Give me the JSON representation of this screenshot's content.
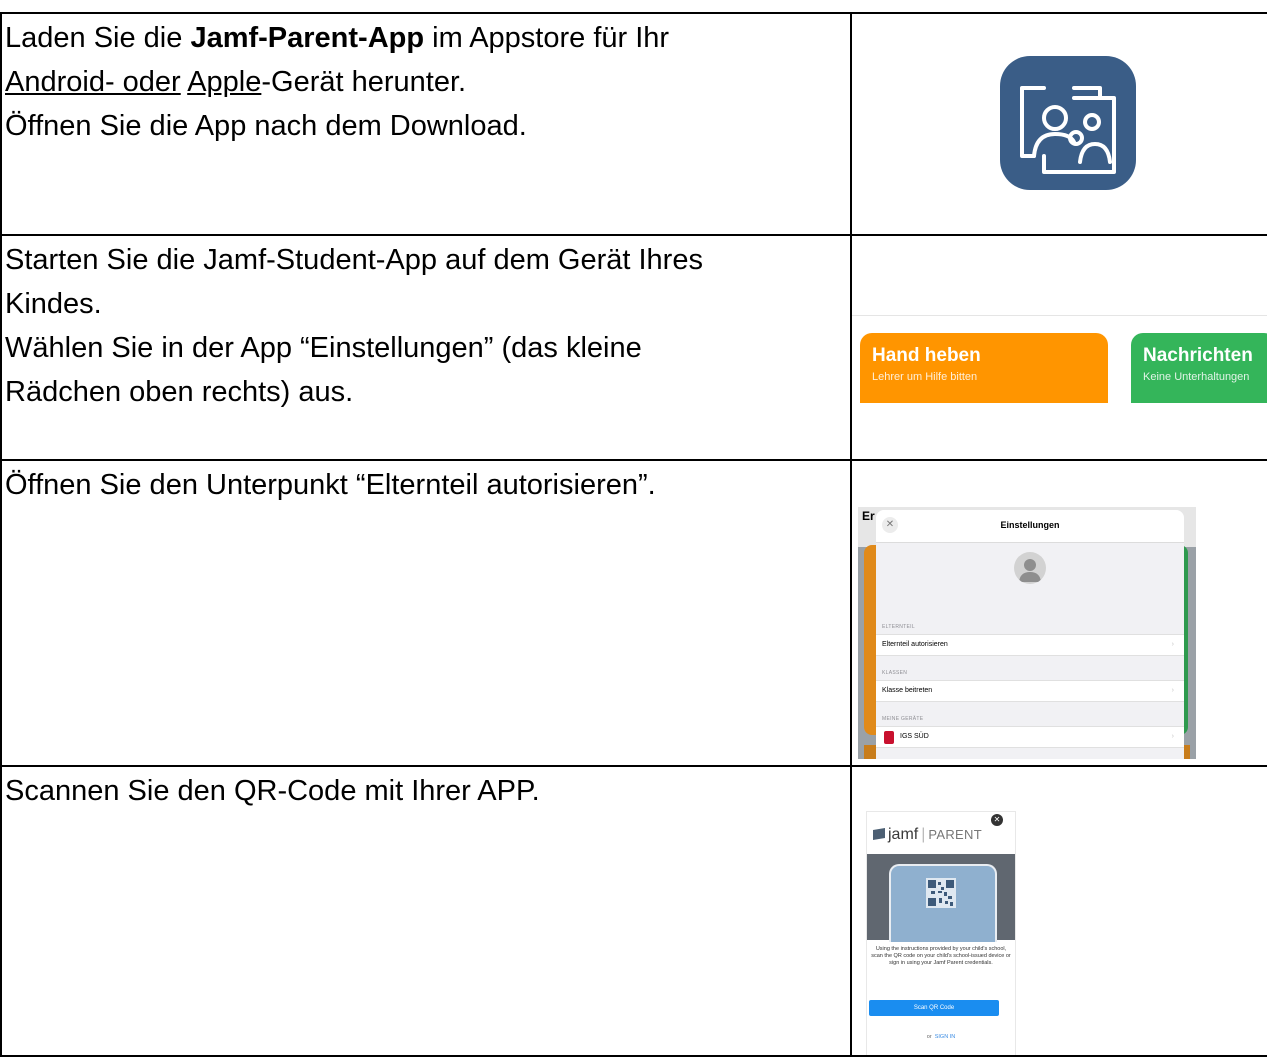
{
  "rows": [
    {
      "lines": [
        {
          "before": "Laden Sie die ",
          "bold": "Jamf-Parent-App",
          "after": " im Appstore für Ihr"
        },
        {
          "link1": "Android- oder",
          "mid": " ",
          "link2": "Apple",
          "after": "-Gerät herunter."
        },
        {
          "text": "Öffnen Sie die App nach dem Download."
        }
      ]
    },
    {
      "lines": [
        "Starten Sie die Jamf-Student-App auf dem Gerät Ihres",
        "Kindes.",
        "Wählen Sie in der App “Einstellungen” (das kleine",
        "Rädchen oben rechts) aus."
      ],
      "tiles": [
        {
          "title": "Hand heben",
          "subtitle": "Lehrer um Hilfe bitten",
          "color": "#ff9500"
        },
        {
          "title": "Nachrichten",
          "subtitle": "Keine Unterhaltungen",
          "color": "#34b55a"
        }
      ]
    },
    {
      "lines": [
        "Öffnen Sie den Unterpunkt “Elternteil autorisieren”."
      ],
      "settings": {
        "corner_text": "Er",
        "close": "✕",
        "title": "Einstellungen",
        "sections": [
          {
            "header": "ELTERNTEIL",
            "item": "Elternteil autorisieren"
          },
          {
            "header": "KLASSEN",
            "item": "Klasse beitreten"
          },
          {
            "header": "MEINE GERÄTE",
            "item": "IGS SÜD"
          }
        ],
        "chevron": "›"
      }
    },
    {
      "lines": [
        "Scannen Sie den QR-Code mit Ihrer APP."
      ],
      "jamf_parent": {
        "logo": "jamf",
        "brand": "PARENT",
        "close": "✕",
        "body": "Using the instructions provided by your child's school, scan the QR code on your child's school-issued device or sign in using your Jamf Parent credentials.",
        "button": "Scan QR Code",
        "or": "or",
        "signin": "SIGN IN"
      }
    }
  ],
  "colors": {
    "app_icon": "#3a5d87",
    "orange": "#ff9500",
    "green": "#34b55a",
    "button_blue": "#1a8df0"
  }
}
